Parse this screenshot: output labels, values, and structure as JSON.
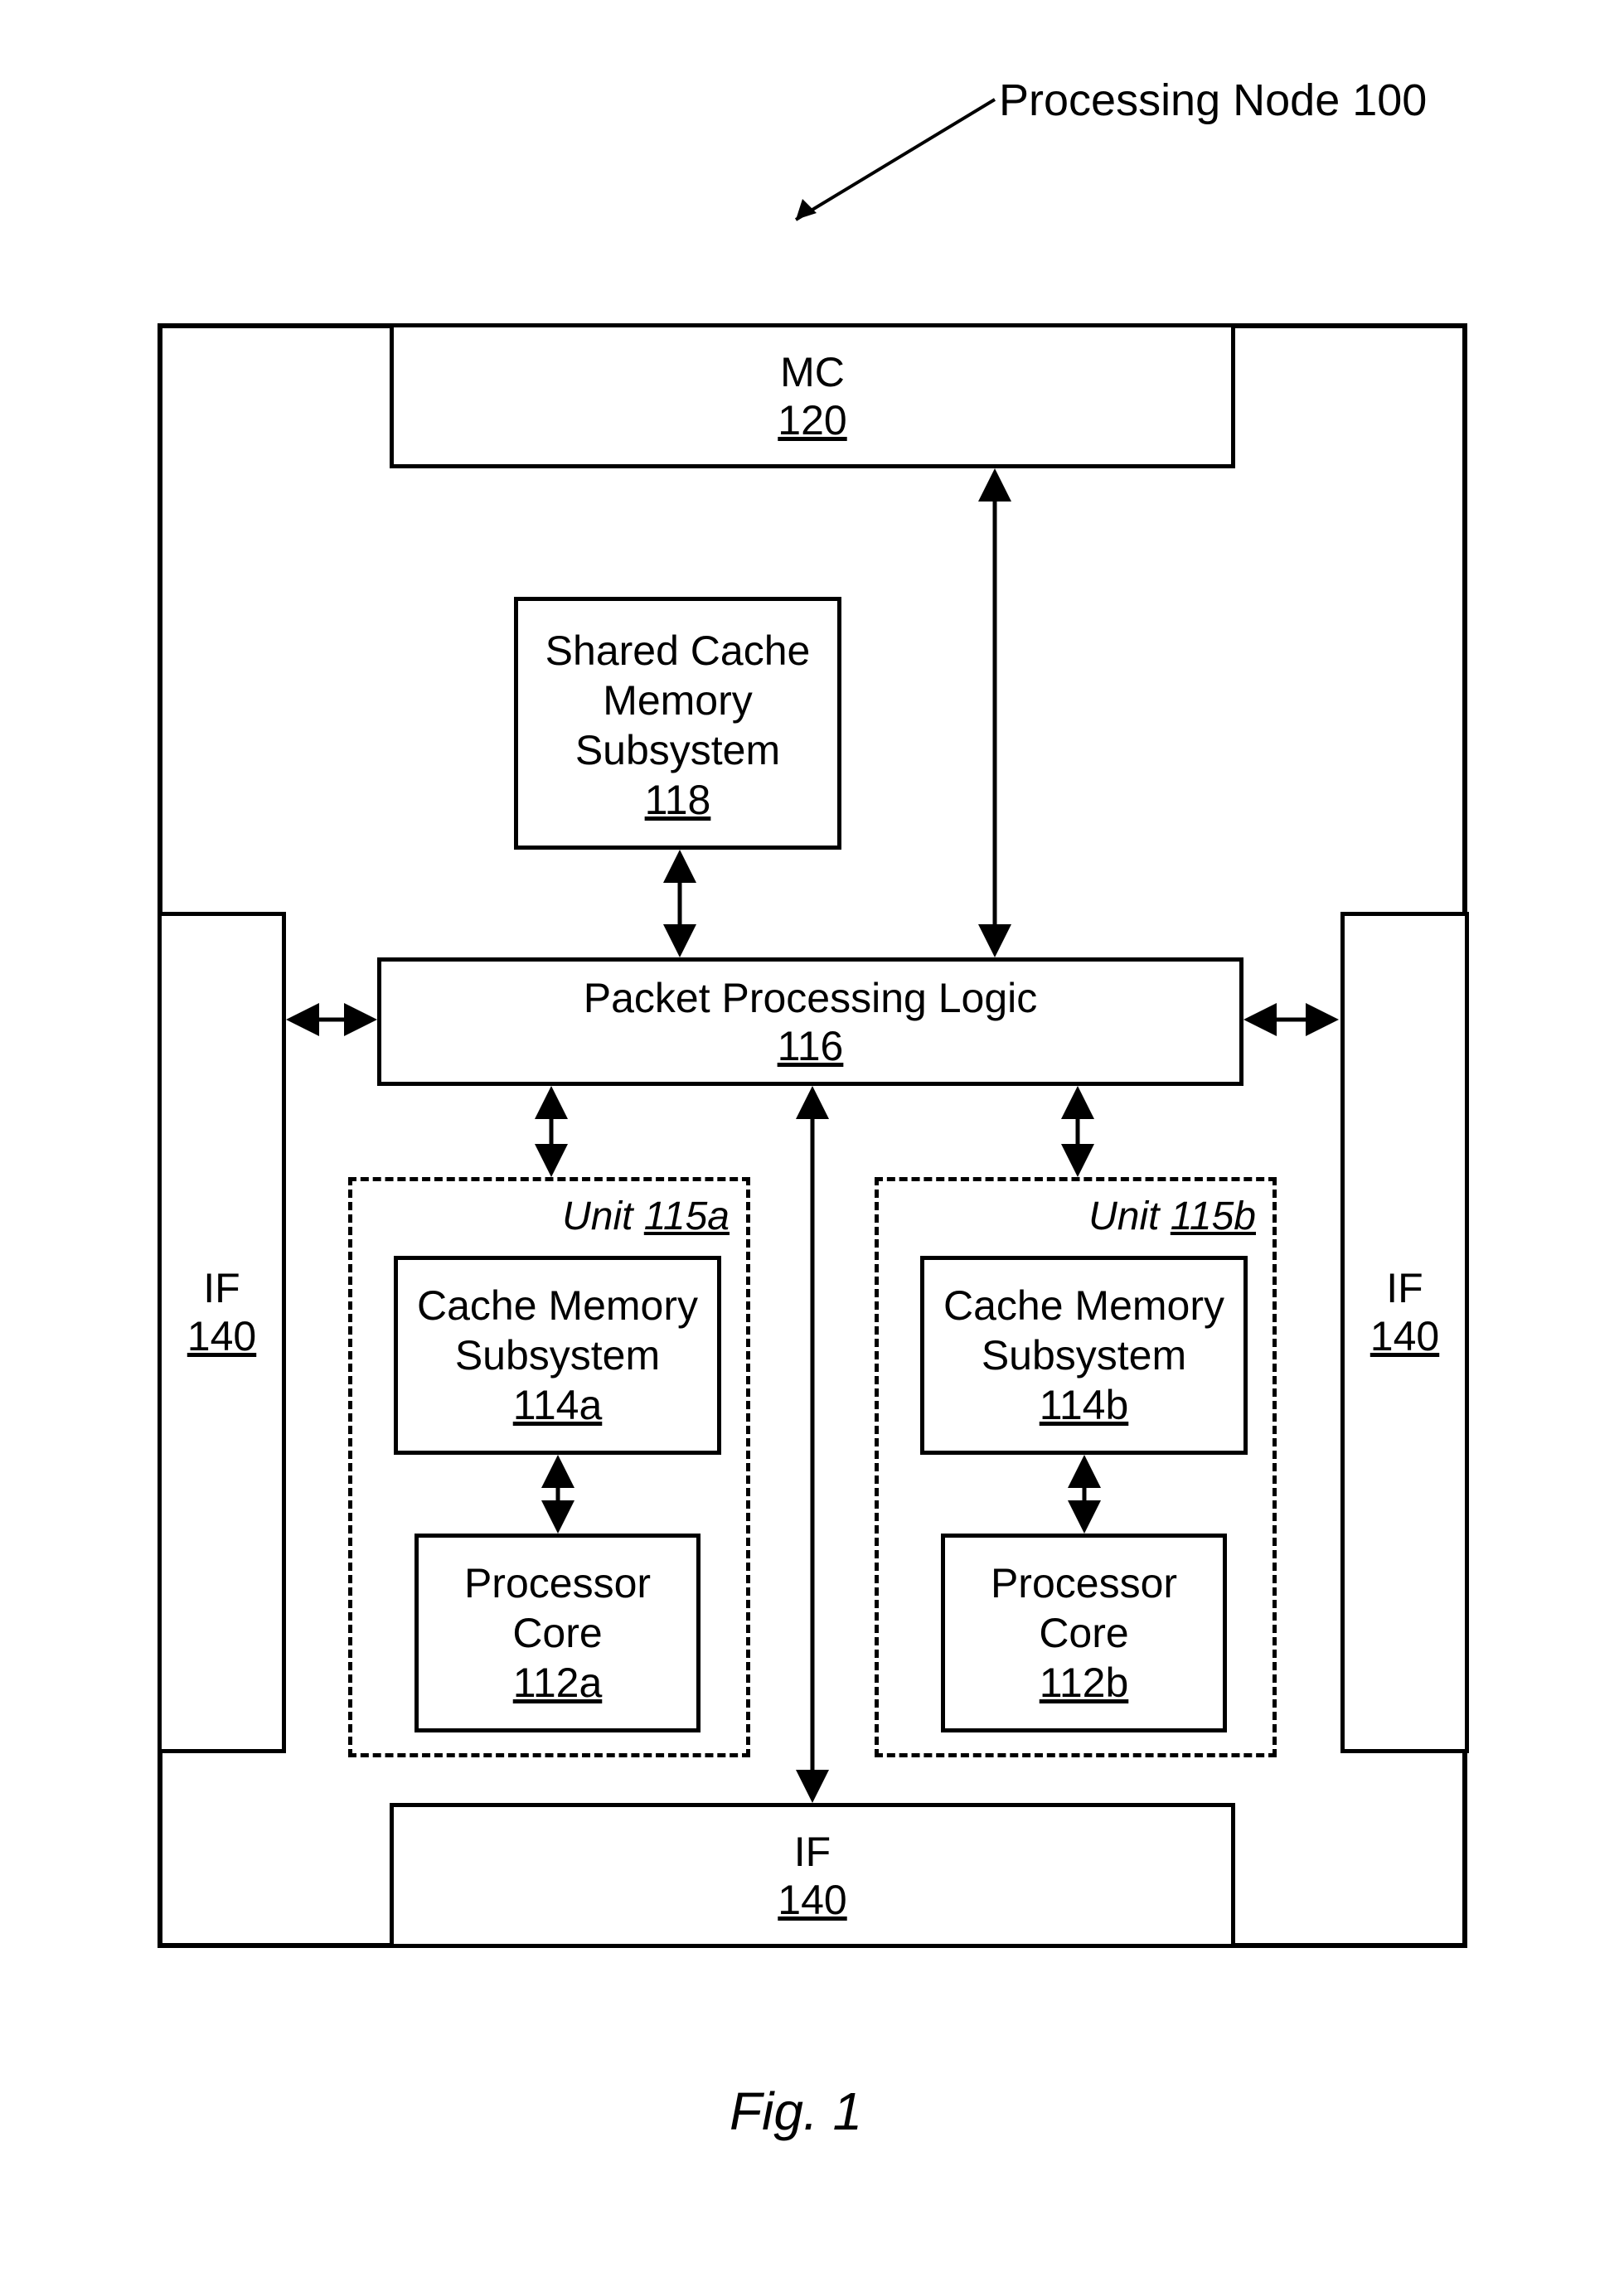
{
  "title": "Processing Node 100",
  "mc": {
    "name": "MC",
    "ref": "120"
  },
  "shared_cache": {
    "line1": "Shared Cache",
    "line2": "Memory",
    "line3": "Subsystem",
    "ref": "118"
  },
  "ppl": {
    "name": "Packet Processing Logic",
    "ref": "116"
  },
  "if_left": {
    "name": "IF",
    "ref": "140"
  },
  "if_right": {
    "name": "IF",
    "ref": "140"
  },
  "if_bottom": {
    "name": "IF",
    "ref": "140"
  },
  "unit_a": {
    "label": "Unit",
    "ref": "115a",
    "cache": {
      "line1": "Cache Memory",
      "line2": "Subsystem",
      "ref": "114a"
    },
    "core": {
      "line1": "Processor",
      "line2": "Core",
      "ref": "112a"
    }
  },
  "unit_b": {
    "label": "Unit",
    "ref": "115b",
    "cache": {
      "line1": "Cache Memory",
      "line2": "Subsystem",
      "ref": "114b"
    },
    "core": {
      "line1": "Processor",
      "line2": "Core",
      "ref": "112b"
    }
  },
  "figure": "Fig. 1"
}
